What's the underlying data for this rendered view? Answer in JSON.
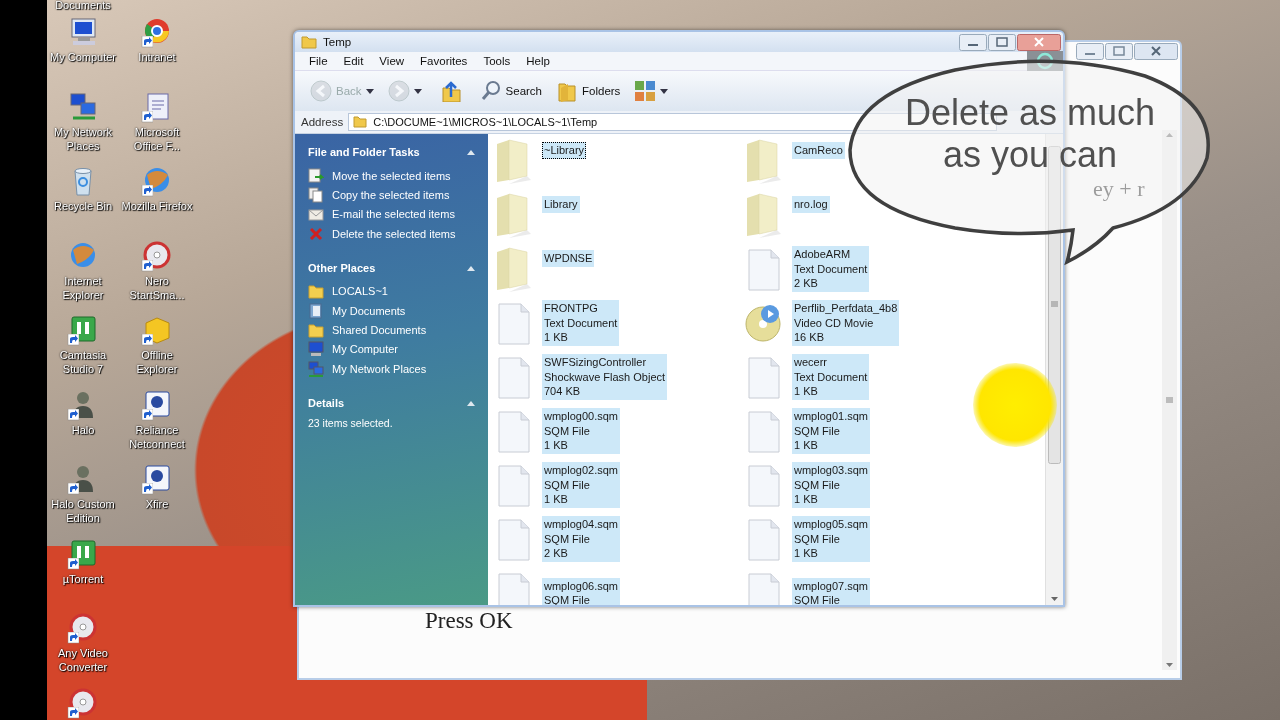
{
  "desktop": {
    "columns": [
      {
        "icons": [
          {
            "label": "Documents",
            "kind": "partial"
          },
          {
            "label": "My Computer",
            "kind": "computer",
            "shortcut": false
          },
          {
            "label": "My Network Places",
            "kind": "network",
            "shortcut": false
          },
          {
            "label": "Recycle Bin",
            "kind": "recycle",
            "shortcut": false
          },
          {
            "label": "Internet Explorer",
            "kind": "globe",
            "shortcut": false
          },
          {
            "label": "Camtasia Studio 7",
            "kind": "app-green",
            "shortcut": true
          },
          {
            "label": "Halo",
            "kind": "figure",
            "shortcut": true
          },
          {
            "label": "Halo Custom Edition",
            "kind": "figure",
            "shortcut": true
          },
          {
            "label": "µTorrent",
            "kind": "app-green",
            "shortcut": true
          },
          {
            "label": "Any Video Converter",
            "kind": "disc",
            "shortcut": true
          },
          {
            "kind": "disc",
            "shortcut": true
          }
        ]
      },
      {
        "icons": [
          {
            "label": "Intranet",
            "kind": "ring",
            "shortcut": true
          },
          {
            "label": "Microsoft Office F...",
            "kind": "document",
            "shortcut": true
          },
          {
            "label": "Mozilla Firefox",
            "kind": "globe",
            "shortcut": true
          },
          {
            "label": "Nero StartSma...",
            "kind": "disc",
            "shortcut": true
          },
          {
            "label": "Offline Explorer",
            "kind": "box",
            "shortcut": true
          },
          {
            "label": "Reliance Netconnect",
            "kind": "app-blue",
            "shortcut": true
          },
          {
            "label": "Xfire",
            "kind": "app-blue",
            "shortcut": true
          }
        ]
      }
    ]
  },
  "background_window": {
    "texts": [
      {
        "text": "ey + r",
        "kind": "middle"
      },
      {
        "text": "Press OK",
        "kind": "lower"
      }
    ]
  },
  "window": {
    "title": "Temp",
    "menu": [
      "File",
      "Edit",
      "View",
      "Favorites",
      "Tools",
      "Help"
    ],
    "toolbar": [
      {
        "kind": "back",
        "label": "Back",
        "disabled": true
      },
      {
        "kind": "forward",
        "disabled": true
      },
      {
        "kind": "up",
        "disabled": false
      },
      {
        "kind": "search",
        "label": "Search",
        "disabled": false
      },
      {
        "kind": "folders",
        "label": "Folders",
        "disabled": false
      },
      {
        "kind": "views",
        "disabled": false
      }
    ],
    "address": {
      "label": "Address",
      "value": "C:\\DOCUME~1\\MICROS~1\\LOCALS~1\\Temp"
    },
    "sidebar": {
      "sections": [
        {
          "title": "File and Folder Tasks",
          "expanded": true,
          "items": [
            {
              "label": "Move the selected items",
              "kind": "move"
            },
            {
              "label": "Copy the selected items",
              "kind": "copy"
            },
            {
              "label": "E-mail the selected items",
              "kind": "email"
            },
            {
              "label": "Delete the selected items",
              "kind": "delete"
            }
          ]
        },
        {
          "title": "Other Places",
          "expanded": true,
          "items": [
            {
              "label": "LOCALS~1",
              "kind": "folder"
            },
            {
              "label": "My Documents",
              "kind": "documents"
            },
            {
              "label": "Shared Documents",
              "kind": "folder"
            },
            {
              "label": "My Computer",
              "kind": "computer"
            },
            {
              "label": "My Network Places",
              "kind": "network"
            }
          ]
        },
        {
          "title": "Details",
          "expanded": true,
          "text": "23 items selected."
        }
      ]
    },
    "files": [
      {
        "name": "~Library",
        "kind": "folder",
        "selected": true,
        "focused": true
      },
      {
        "name": "CamReco",
        "kind": "folder",
        "selected": true,
        "focused": false
      },
      {
        "name": "Library",
        "kind": "folder",
        "selected": true,
        "focused": false
      },
      {
        "name": "nro.log",
        "kind": "folder",
        "selected": true,
        "focused": false
      },
      {
        "name": "WPDNSE",
        "kind": "folder",
        "selected": true,
        "focused": false
      },
      {
        "name": "AdobeARM",
        "type": "Text Document",
        "size": "2 KB",
        "kind": "document",
        "selected": true,
        "focused": false
      },
      {
        "name": "FRONTPG",
        "type": "Text Document",
        "size": "1 KB",
        "kind": "document",
        "selected": true,
        "focused": false
      },
      {
        "name": "Perflib_Perfdata_4b8",
        "type": "Video CD Movie",
        "size": "16 KB",
        "kind": "video",
        "selected": true,
        "focused": false
      },
      {
        "name": "SWFSizingController",
        "type": "Shockwave Flash Object",
        "size": "704 KB",
        "kind": "document",
        "selected": true,
        "focused": false
      },
      {
        "name": "wecerr",
        "type": "Text Document",
        "size": "1 KB",
        "kind": "document",
        "selected": true,
        "focused": false
      },
      {
        "name": "wmplog00.sqm",
        "type": "SQM File",
        "size": "1 KB",
        "kind": "document",
        "selected": true,
        "focused": false
      },
      {
        "name": "wmplog01.sqm",
        "type": "SQM File",
        "size": "1 KB",
        "kind": "document",
        "selected": true,
        "focused": false
      },
      {
        "name": "wmplog02.sqm",
        "type": "SQM File",
        "size": "1 KB",
        "kind": "document",
        "selected": true,
        "focused": false
      },
      {
        "name": "wmplog03.sqm",
        "type": "SQM File",
        "size": "1 KB",
        "kind": "document",
        "selected": true,
        "focused": false
      },
      {
        "name": "wmplog04.sqm",
        "type": "SQM File",
        "size": "2 KB",
        "kind": "document",
        "selected": true,
        "focused": false
      },
      {
        "name": "wmplog05.sqm",
        "type": "SQM File",
        "size": "1 KB",
        "kind": "document",
        "selected": true,
        "focused": false
      },
      {
        "name": "wmplog06.sqm",
        "type": "SQM File",
        "kind": "document",
        "selected": true,
        "focused": false
      },
      {
        "name": "wmplog07.sqm",
        "type": "SQM File",
        "kind": "document",
        "selected": true,
        "focused": false
      }
    ]
  },
  "callout": {
    "text": "Delete as much as you can"
  }
}
